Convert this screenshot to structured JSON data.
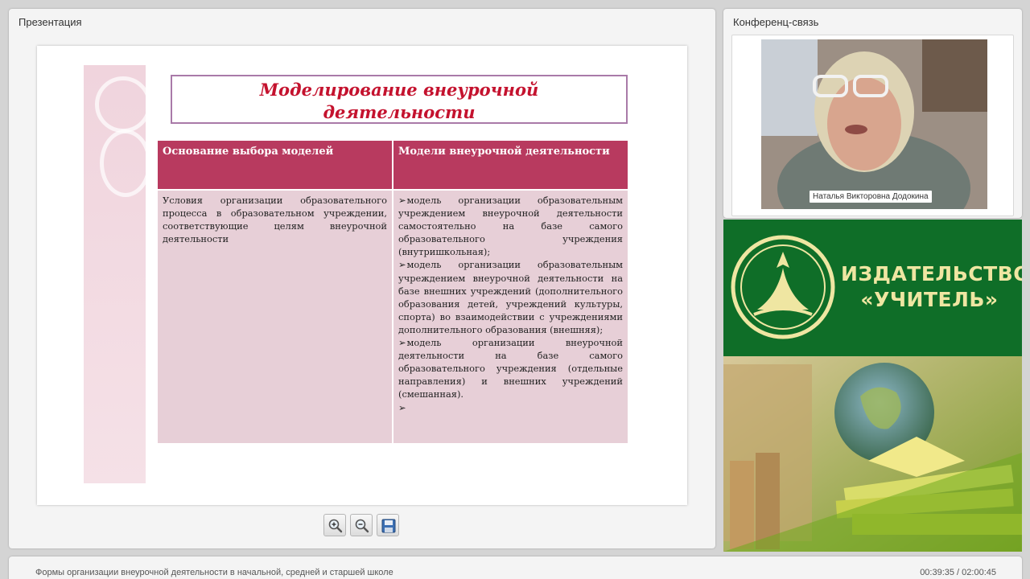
{
  "presentation": {
    "title": "Презентация",
    "slide": {
      "title": "Моделирование внеурочной\nдеятельности",
      "table": {
        "headers": [
          "Основание выбора моделей",
          "Модели внеурочной деятельности"
        ],
        "basis": "Условия организации образовательного процесса в образовательном учреждении, соответствующие целям внеурочной деятельности",
        "models": [
          "модель организации образовательным учреждением внеурочной деятельности самостоятельно на базе самого образовательного учреждения (внутришкольная);",
          "модель организации образовательным учреждением внеурочной деятельности на базе внешних учреждений (дополнительного образования детей, учреждений культуры, спорта) во взаимодействии с учреждениями дополнительного образования (внешняя);",
          "модель организации внеурочной деятельности на базе самого образовательного учреждения (отдельные направления) и внешних учреждений (смешанная).",
          ""
        ],
        "bullet_marker": "➢"
      }
    },
    "toolbar": {
      "zoom_in_icon": "zoom-in-icon",
      "zoom_out_icon": "zoom-out-icon",
      "save_icon": "save-icon"
    }
  },
  "conference": {
    "title": "Конференц-связь",
    "speaker_name": "Наталья Викторовна Додокина"
  },
  "banner": {
    "text": "ИЗДАТЕЛЬСТВО\n«УЧИТЕЛЬ»",
    "colors": {
      "green": "#0f6e28",
      "text": "#efe6a2"
    }
  },
  "footer": {
    "title": "Формы организации внеурочной деятельности в начальной, средней и старшей школе",
    "time": "00:39:35 / 02:00:45"
  },
  "colors": {
    "table_header": "#b83a5f",
    "table_body": "#e7cfd7",
    "slide_title": "#c4122e"
  }
}
